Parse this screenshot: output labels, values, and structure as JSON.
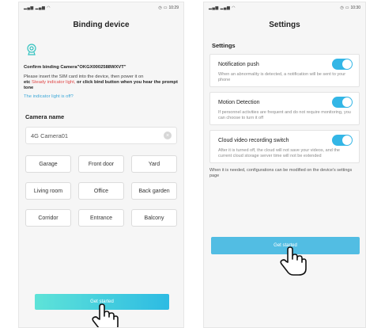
{
  "left": {
    "status_time": "10:29",
    "title": "Binding device",
    "confirm_prefix": "Confirm binding  Camera",
    "device_id": "\"OKGX0002588WXVT\"",
    "instr_1": "Please insert the SIM card into the device, then power it on",
    "instr_2": "etc ",
    "instr_red": "Steady indicator light,",
    "instr_3": " or click bind button when you hear the prompt tone",
    "help_link": "The indicator light is off?",
    "camera_name_label": "Camera name",
    "camera_name_value": "4G Camera01",
    "presets": [
      "Garage",
      "Front door",
      "Yard",
      "Living room",
      "Office",
      "Back garden",
      "Corridor",
      "Entrance",
      "Balcony"
    ],
    "button": "Get started"
  },
  "right": {
    "status_time": "10:30",
    "title": "Settings",
    "section": "Settings",
    "items": [
      {
        "title": "Notification push",
        "desc": "When an abnormality is detected, a notification will be sent to your phone",
        "enabled": true
      },
      {
        "title": "Motion Detection",
        "desc": "If personnel activities are frequent and do not require monitoring, you can choose to turn it off",
        "enabled": true
      },
      {
        "title": "Cloud video recording switch",
        "desc": "After it is turned off, the cloud will not save your videos, and the current cloud storage server time will not be extended",
        "enabled": true
      }
    ],
    "note": "When it is needed, configurations can be modified on the device's settings page",
    "button": "Get started"
  },
  "colors": {
    "accent": "#33b6e6",
    "gradient_start": "#5ee3d8",
    "gradient_end": "#2dbbe3",
    "warning": "#e04848",
    "link": "#3fa9d8"
  }
}
